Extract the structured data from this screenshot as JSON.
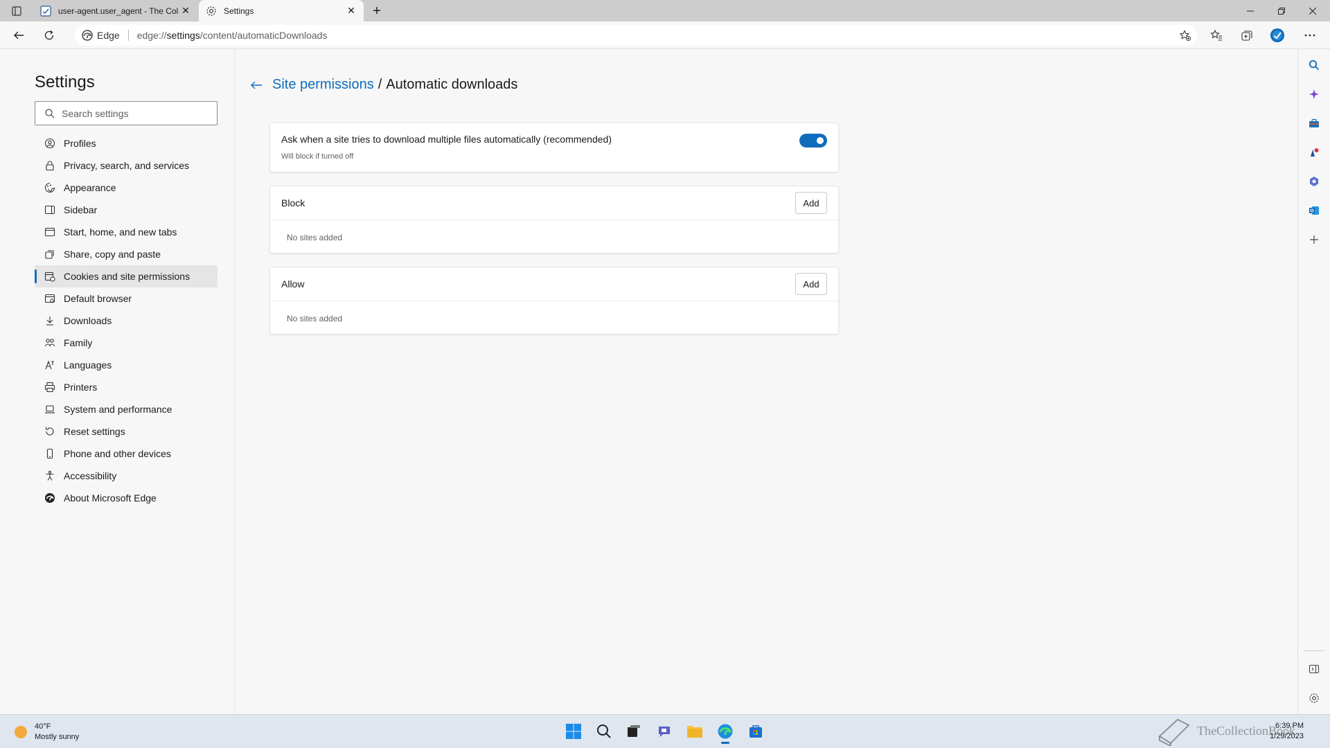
{
  "browser": {
    "tabs": [
      {
        "title": "user-agent.user_agent - The Coll",
        "active": false
      },
      {
        "title": "Settings",
        "active": true
      }
    ],
    "address": {
      "chip_label": "Edge",
      "url_prefix": "edge://",
      "url_host": "settings",
      "url_path": "/content/automaticDownloads"
    },
    "accent_color": "#0f6cbd"
  },
  "settings_nav": {
    "title": "Settings",
    "search_placeholder": "Search settings",
    "items": [
      {
        "label": "Profiles",
        "icon": "profile-icon"
      },
      {
        "label": "Privacy, search, and services",
        "icon": "lock-icon"
      },
      {
        "label": "Appearance",
        "icon": "appearance-icon"
      },
      {
        "label": "Sidebar",
        "icon": "sidebar-icon"
      },
      {
        "label": "Start, home, and new tabs",
        "icon": "home-icon"
      },
      {
        "label": "Share, copy and paste",
        "icon": "share-icon"
      },
      {
        "label": "Cookies and site permissions",
        "icon": "cookies-icon",
        "active": true
      },
      {
        "label": "Default browser",
        "icon": "browser-icon"
      },
      {
        "label": "Downloads",
        "icon": "download-icon"
      },
      {
        "label": "Family",
        "icon": "family-icon"
      },
      {
        "label": "Languages",
        "icon": "language-icon"
      },
      {
        "label": "Printers",
        "icon": "printer-icon"
      },
      {
        "label": "System and performance",
        "icon": "laptop-icon"
      },
      {
        "label": "Reset settings",
        "icon": "reset-icon"
      },
      {
        "label": "Phone and other devices",
        "icon": "phone-icon"
      },
      {
        "label": "Accessibility",
        "icon": "accessibility-icon"
      },
      {
        "label": "About Microsoft Edge",
        "icon": "edge-logo-icon"
      }
    ]
  },
  "page": {
    "breadcrumb_parent": "Site permissions",
    "breadcrumb_sep": "/",
    "breadcrumb_current": "Automatic downloads",
    "toggle_card": {
      "title": "Ask when a site tries to download multiple files automatically (recommended)",
      "subtitle": "Will block if turned off",
      "enabled": true
    },
    "block": {
      "label": "Block",
      "add_label": "Add",
      "empty_text": "No sites added"
    },
    "allow": {
      "label": "Allow",
      "add_label": "Add",
      "empty_text": "No sites added"
    }
  },
  "taskbar": {
    "weather_temp": "40°F",
    "weather_desc": "Mostly sunny",
    "time": "6:39 PM",
    "date": "1/29/2023",
    "watermark": "TheCollectionBook"
  }
}
